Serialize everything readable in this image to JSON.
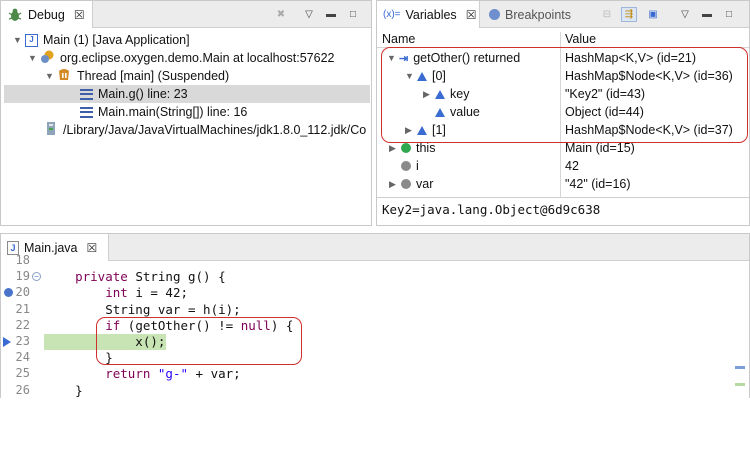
{
  "debug_view": {
    "tab_label": "Debug",
    "tree": [
      {
        "label": "Main (1) [Java Application]"
      },
      {
        "label": "org.eclipse.oxygen.demo.Main at localhost:57622"
      },
      {
        "label": "Thread [main] (Suspended)"
      },
      {
        "label": "Main.g() line: 23"
      },
      {
        "label": "Main.main(String[]) line: 16"
      },
      {
        "label": "/Library/Java/JavaVirtualMachines/jdk1.8.0_112.jdk/Co"
      }
    ]
  },
  "variables_view": {
    "tab_label": "Variables",
    "tab_prefix": "(x)=",
    "breakpoints_label": "Breakpoints",
    "col_name": "Name",
    "col_value": "Value",
    "rows": [
      {
        "name": "getOther() returned",
        "value": "HashMap<K,V>  (id=21)"
      },
      {
        "name": "[0]",
        "value": "HashMap$Node<K,V>  (id=36)"
      },
      {
        "name": "key",
        "value": "\"Key2\" (id=43)"
      },
      {
        "name": "value",
        "value": "Object  (id=44)"
      },
      {
        "name": "[1]",
        "value": "HashMap$Node<K,V>  (id=37)"
      },
      {
        "name": "this",
        "value": "Main  (id=15)"
      },
      {
        "name": "i",
        "value": "42"
      },
      {
        "name": "var",
        "value": "\"42\" (id=16)"
      }
    ],
    "detail": "Key2=java.lang.Object@6d9c638"
  },
  "editor": {
    "tab_label": "Main.java",
    "lines": [
      {
        "num": "18",
        "parts": []
      },
      {
        "num": "19",
        "parts": [
          [
            "",
            "    "
          ],
          [
            "kw",
            "private"
          ],
          [
            "",
            " String g() {"
          ]
        ]
      },
      {
        "num": "20",
        "parts": [
          [
            "",
            "        "
          ],
          [
            "kw",
            "int"
          ],
          [
            "",
            " i = 42;"
          ]
        ]
      },
      {
        "num": "21",
        "parts": [
          [
            "",
            "        String var = h(i);"
          ]
        ]
      },
      {
        "num": "22",
        "parts": [
          [
            "",
            "        "
          ],
          [
            "kw",
            "if"
          ],
          [
            "",
            " (getOther() != "
          ],
          [
            "kw",
            "null"
          ],
          [
            "",
            ") {"
          ]
        ]
      },
      {
        "num": "23",
        "parts": [
          [
            "",
            "            x();"
          ]
        ]
      },
      {
        "num": "24",
        "parts": [
          [
            "",
            "        }"
          ]
        ]
      },
      {
        "num": "25",
        "parts": [
          [
            "",
            "        "
          ],
          [
            "kw",
            "return"
          ],
          [
            "",
            " "
          ],
          [
            "str",
            "\"g-\""
          ],
          [
            "",
            " + var;"
          ]
        ]
      },
      {
        "num": "26",
        "parts": [
          [
            "",
            "    }"
          ]
        ]
      }
    ]
  },
  "colors": {
    "accent": "#3a6bd2",
    "highlight_line": "#c9e4b4",
    "annotation_red": "#d0302b"
  }
}
